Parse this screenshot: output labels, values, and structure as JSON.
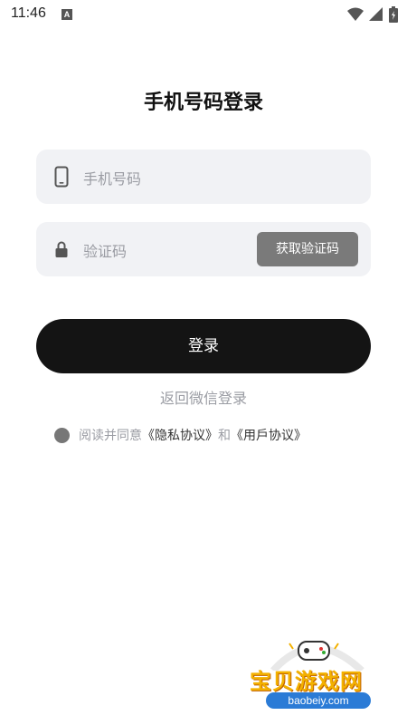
{
  "status_bar": {
    "time": "11:46",
    "notification_icon": "a-icon",
    "wifi_icon": "wifi-icon",
    "signal_icon": "signal-icon",
    "battery_icon": "battery-icon"
  },
  "page": {
    "title": "手机号码登录"
  },
  "phone_field": {
    "icon": "phone-icon",
    "placeholder": "手机号码"
  },
  "code_field": {
    "icon": "lock-icon",
    "placeholder": "验证码",
    "get_code_label": "获取验证码"
  },
  "login_button": {
    "label": "登录"
  },
  "back_link": {
    "label": "返回微信登录"
  },
  "agreement": {
    "prefix": "阅读并同意",
    "privacy": "《隐私协议》",
    "and": "和",
    "user": "《用戶协议》"
  },
  "watermark": {
    "text": "宝贝游戏网",
    "domain": "baobeiy.com"
  },
  "colors": {
    "primary": "#141414",
    "field_bg": "#f1f2f5",
    "placeholder": "#9a9ca3",
    "code_button": "#7a7a7a"
  }
}
